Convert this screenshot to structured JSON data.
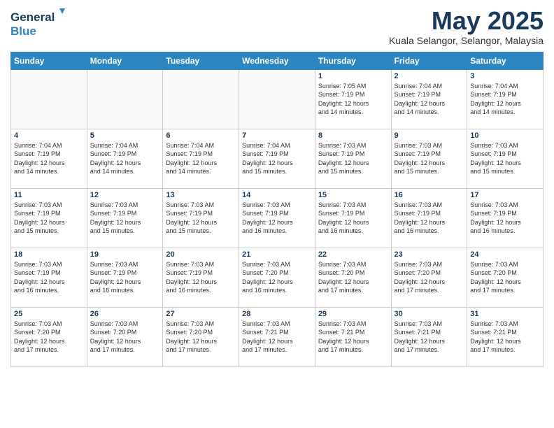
{
  "header": {
    "logo_general": "General",
    "logo_blue": "Blue",
    "month_title": "May 2025",
    "location": "Kuala Selangor, Selangor, Malaysia"
  },
  "weekdays": [
    "Sunday",
    "Monday",
    "Tuesday",
    "Wednesday",
    "Thursday",
    "Friday",
    "Saturday"
  ],
  "weeks": [
    [
      {
        "day": "",
        "info": ""
      },
      {
        "day": "",
        "info": ""
      },
      {
        "day": "",
        "info": ""
      },
      {
        "day": "",
        "info": ""
      },
      {
        "day": "1",
        "info": "Sunrise: 7:05 AM\nSunset: 7:19 PM\nDaylight: 12 hours\nand 14 minutes."
      },
      {
        "day": "2",
        "info": "Sunrise: 7:04 AM\nSunset: 7:19 PM\nDaylight: 12 hours\nand 14 minutes."
      },
      {
        "day": "3",
        "info": "Sunrise: 7:04 AM\nSunset: 7:19 PM\nDaylight: 12 hours\nand 14 minutes."
      }
    ],
    [
      {
        "day": "4",
        "info": "Sunrise: 7:04 AM\nSunset: 7:19 PM\nDaylight: 12 hours\nand 14 minutes."
      },
      {
        "day": "5",
        "info": "Sunrise: 7:04 AM\nSunset: 7:19 PM\nDaylight: 12 hours\nand 14 minutes."
      },
      {
        "day": "6",
        "info": "Sunrise: 7:04 AM\nSunset: 7:19 PM\nDaylight: 12 hours\nand 14 minutes."
      },
      {
        "day": "7",
        "info": "Sunrise: 7:04 AM\nSunset: 7:19 PM\nDaylight: 12 hours\nand 15 minutes."
      },
      {
        "day": "8",
        "info": "Sunrise: 7:03 AM\nSunset: 7:19 PM\nDaylight: 12 hours\nand 15 minutes."
      },
      {
        "day": "9",
        "info": "Sunrise: 7:03 AM\nSunset: 7:19 PM\nDaylight: 12 hours\nand 15 minutes."
      },
      {
        "day": "10",
        "info": "Sunrise: 7:03 AM\nSunset: 7:19 PM\nDaylight: 12 hours\nand 15 minutes."
      }
    ],
    [
      {
        "day": "11",
        "info": "Sunrise: 7:03 AM\nSunset: 7:19 PM\nDaylight: 12 hours\nand 15 minutes."
      },
      {
        "day": "12",
        "info": "Sunrise: 7:03 AM\nSunset: 7:19 PM\nDaylight: 12 hours\nand 15 minutes."
      },
      {
        "day": "13",
        "info": "Sunrise: 7:03 AM\nSunset: 7:19 PM\nDaylight: 12 hours\nand 15 minutes."
      },
      {
        "day": "14",
        "info": "Sunrise: 7:03 AM\nSunset: 7:19 PM\nDaylight: 12 hours\nand 16 minutes."
      },
      {
        "day": "15",
        "info": "Sunrise: 7:03 AM\nSunset: 7:19 PM\nDaylight: 12 hours\nand 16 minutes."
      },
      {
        "day": "16",
        "info": "Sunrise: 7:03 AM\nSunset: 7:19 PM\nDaylight: 12 hours\nand 16 minutes."
      },
      {
        "day": "17",
        "info": "Sunrise: 7:03 AM\nSunset: 7:19 PM\nDaylight: 12 hours\nand 16 minutes."
      }
    ],
    [
      {
        "day": "18",
        "info": "Sunrise: 7:03 AM\nSunset: 7:19 PM\nDaylight: 12 hours\nand 16 minutes."
      },
      {
        "day": "19",
        "info": "Sunrise: 7:03 AM\nSunset: 7:19 PM\nDaylight: 12 hours\nand 16 minutes."
      },
      {
        "day": "20",
        "info": "Sunrise: 7:03 AM\nSunset: 7:19 PM\nDaylight: 12 hours\nand 16 minutes."
      },
      {
        "day": "21",
        "info": "Sunrise: 7:03 AM\nSunset: 7:20 PM\nDaylight: 12 hours\nand 16 minutes."
      },
      {
        "day": "22",
        "info": "Sunrise: 7:03 AM\nSunset: 7:20 PM\nDaylight: 12 hours\nand 17 minutes."
      },
      {
        "day": "23",
        "info": "Sunrise: 7:03 AM\nSunset: 7:20 PM\nDaylight: 12 hours\nand 17 minutes."
      },
      {
        "day": "24",
        "info": "Sunrise: 7:03 AM\nSunset: 7:20 PM\nDaylight: 12 hours\nand 17 minutes."
      }
    ],
    [
      {
        "day": "25",
        "info": "Sunrise: 7:03 AM\nSunset: 7:20 PM\nDaylight: 12 hours\nand 17 minutes."
      },
      {
        "day": "26",
        "info": "Sunrise: 7:03 AM\nSunset: 7:20 PM\nDaylight: 12 hours\nand 17 minutes."
      },
      {
        "day": "27",
        "info": "Sunrise: 7:03 AM\nSunset: 7:20 PM\nDaylight: 12 hours\nand 17 minutes."
      },
      {
        "day": "28",
        "info": "Sunrise: 7:03 AM\nSunset: 7:21 PM\nDaylight: 12 hours\nand 17 minutes."
      },
      {
        "day": "29",
        "info": "Sunrise: 7:03 AM\nSunset: 7:21 PM\nDaylight: 12 hours\nand 17 minutes."
      },
      {
        "day": "30",
        "info": "Sunrise: 7:03 AM\nSunset: 7:21 PM\nDaylight: 12 hours\nand 17 minutes."
      },
      {
        "day": "31",
        "info": "Sunrise: 7:03 AM\nSunset: 7:21 PM\nDaylight: 12 hours\nand 17 minutes."
      }
    ]
  ]
}
